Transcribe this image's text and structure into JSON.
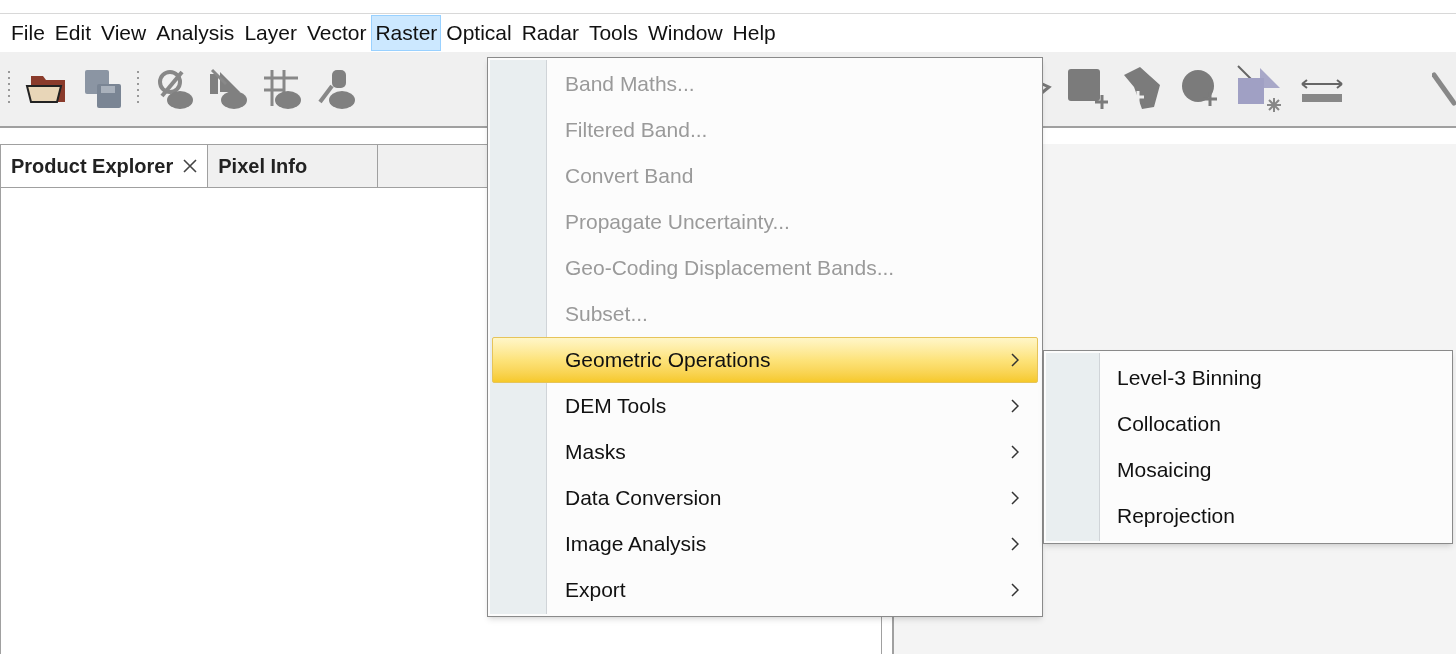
{
  "menubar": [
    {
      "label": "File",
      "selected": false
    },
    {
      "label": "Edit",
      "selected": false
    },
    {
      "label": "View",
      "selected": false
    },
    {
      "label": "Analysis",
      "selected": false
    },
    {
      "label": "Layer",
      "selected": false
    },
    {
      "label": "Vector",
      "selected": false
    },
    {
      "label": "Raster",
      "selected": true
    },
    {
      "label": "Optical",
      "selected": false
    },
    {
      "label": "Radar",
      "selected": false
    },
    {
      "label": "Tools",
      "selected": false
    },
    {
      "label": "Window",
      "selected": false
    },
    {
      "label": "Help",
      "selected": false
    }
  ],
  "tabs": [
    {
      "label": "Product Explorer",
      "selected": true,
      "closable": true
    },
    {
      "label": "Pixel Info",
      "selected": false,
      "closable": false
    }
  ],
  "menu": {
    "items": [
      {
        "label": "Band Maths...",
        "disabled": true,
        "selected": false,
        "submenu": false
      },
      {
        "label": "Filtered Band...",
        "disabled": true,
        "selected": false,
        "submenu": false
      },
      {
        "label": "Convert Band",
        "disabled": true,
        "selected": false,
        "submenu": false
      },
      {
        "label": "Propagate Uncertainty...",
        "disabled": true,
        "selected": false,
        "submenu": false
      },
      {
        "label": "Geo-Coding Displacement Bands...",
        "disabled": true,
        "selected": false,
        "submenu": false
      },
      {
        "label": "Subset...",
        "disabled": true,
        "selected": false,
        "submenu": false
      },
      {
        "label": "Geometric Operations",
        "disabled": false,
        "selected": true,
        "submenu": true
      },
      {
        "label": "DEM Tools",
        "disabled": false,
        "selected": false,
        "submenu": true
      },
      {
        "label": "Masks",
        "disabled": false,
        "selected": false,
        "submenu": true
      },
      {
        "label": "Data Conversion",
        "disabled": false,
        "selected": false,
        "submenu": true
      },
      {
        "label": "Image Analysis",
        "disabled": false,
        "selected": false,
        "submenu": true
      },
      {
        "label": "Export",
        "disabled": false,
        "selected": false,
        "submenu": true
      }
    ]
  },
  "submenu": {
    "items": [
      {
        "label": "Level-3 Binning"
      },
      {
        "label": "Collocation"
      },
      {
        "label": "Mosaicing"
      },
      {
        "label": "Reprojection"
      }
    ]
  }
}
